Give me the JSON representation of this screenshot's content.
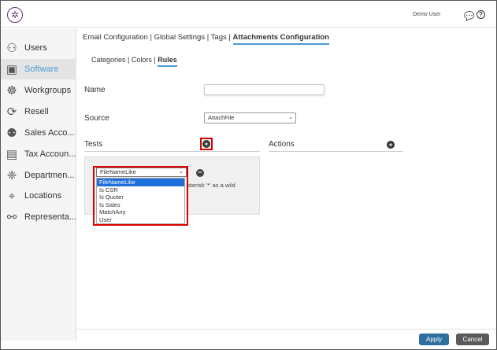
{
  "header": {
    "user": "Demo User"
  },
  "sidebar": {
    "items": [
      {
        "label": "Users",
        "icon": "user-icon"
      },
      {
        "label": "Software",
        "icon": "software-icon",
        "active": true
      },
      {
        "label": "Workgroups",
        "icon": "workgroups-icon"
      },
      {
        "label": "Resell",
        "icon": "resell-icon"
      },
      {
        "label": "Sales Acco...",
        "icon": "sales-accounts-icon"
      },
      {
        "label": "Tax Accoun...",
        "icon": "tax-accounts-icon"
      },
      {
        "label": "Departmen...",
        "icon": "departments-icon"
      },
      {
        "label": "Locations",
        "icon": "locations-icon"
      },
      {
        "label": "Representa...",
        "icon": "representatives-icon"
      }
    ]
  },
  "top_tabs": [
    "Email Configuration",
    "Global Settings",
    "Tags",
    "Attachments Configuration"
  ],
  "sub_tabs": [
    "Categories",
    "Colors",
    "Rules"
  ],
  "form": {
    "name_label": "Name",
    "name_value": "",
    "source_label": "Source",
    "source_value": "AttachFile",
    "tests_label": "Tests",
    "actions_label": "Actions"
  },
  "test_rule": {
    "selected": "FileNameLike",
    "hint": "sterisk '*' as a wild",
    "options": [
      "FileNameLike",
      "Is CSR",
      "Is Quoter",
      "Is Sales",
      "MatchAny",
      "User"
    ]
  },
  "buttons": {
    "apply": "Apply",
    "cancel": "Cancel"
  },
  "colors": {
    "accent": "#4a9bd6",
    "apply": "#2f6f9e",
    "cancel": "#5a5a5a",
    "highlight": "#d00000"
  }
}
